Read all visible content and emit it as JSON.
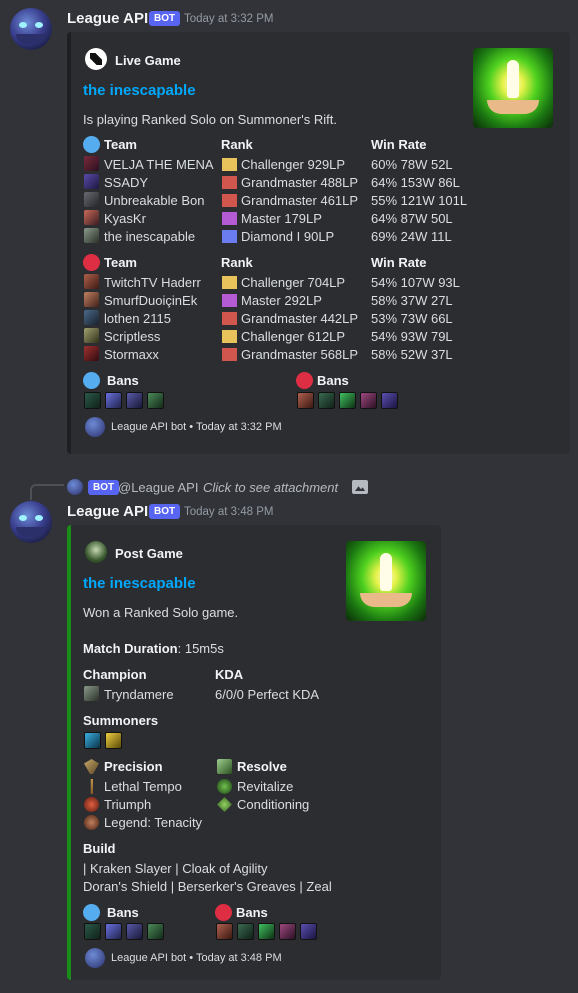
{
  "colors": {
    "background": "#313338",
    "embed": "#2b2d31",
    "link": "#00a8fc",
    "bot_tag": "#5865f2",
    "post_game_accent": "#1a8c1a",
    "blue_side": "#55acee",
    "red_side": "#dd2e44"
  },
  "message1": {
    "author": "League API",
    "bot_tag": "BOT",
    "timestamp": "Today at 3:32 PM",
    "embed": {
      "author_icon": "league-api-logo-icon",
      "author_name": "Live Game",
      "title": "the inescapable",
      "description": "Is playing Ranked Solo on Summoner's Rift.",
      "headers": {
        "team": "Team",
        "rank": "Rank",
        "winrate": "Win Rate"
      },
      "blue_team": [
        {
          "name": "VELJA THE MENA",
          "rank": "Challenger 929LP",
          "winrate": "60% 78W 52L"
        },
        {
          "name": "SSADY",
          "rank": "Grandmaster 488LP",
          "winrate": "64% 153W 86L"
        },
        {
          "name": "Unbreakable Bon",
          "rank": "Grandmaster 461LP",
          "winrate": "55% 121W 101L"
        },
        {
          "name": "KyasKr",
          "rank": "Master 179LP",
          "winrate": "64% 87W 50L"
        },
        {
          "name": "the inescapable",
          "rank": "Diamond I 90LP",
          "winrate": "69% 24W 11L"
        }
      ],
      "red_team": [
        {
          "name": "TwitchTV Haderr",
          "rank": "Challenger 704LP",
          "winrate": "54% 107W 93L"
        },
        {
          "name": "SmurfDuoiçinEk",
          "rank": "Master 292LP",
          "winrate": "58% 37W 27L"
        },
        {
          "name": "lothen 2115",
          "rank": "Grandmaster 442LP",
          "winrate": "53% 73W 66L"
        },
        {
          "name": "Scriptless",
          "rank": "Challenger 612LP",
          "winrate": "54% 93W 79L"
        },
        {
          "name": "Stormaxx",
          "rank": "Grandmaster 568LP",
          "winrate": "58% 52W 37L"
        }
      ],
      "bans_label": "Bans",
      "footer": "League API bot • Today at 3:32 PM"
    }
  },
  "reply": {
    "bot_tag": "BOT",
    "mention": "@League API",
    "text": "Click to see attachment"
  },
  "message2": {
    "author": "League API",
    "bot_tag": "BOT",
    "timestamp": "Today at 3:48 PM",
    "embed": {
      "author_name": "Post Game",
      "title": "the inescapable",
      "description": "Won a Ranked Solo game.",
      "duration_label": "Match Duration",
      "duration_value": ": 15m5s",
      "champion_label": "Champion",
      "champion_value": "Tryndamere",
      "kda_label": "KDA",
      "kda_value": "6/0/0 Perfect KDA",
      "summoners_label": "Summoners",
      "primary_tree": "Precision",
      "primary_runes": [
        "Lethal Tempo",
        "Triumph",
        "Legend: Tenacity"
      ],
      "secondary_tree": "Resolve",
      "secondary_runes": [
        "Revitalize",
        "Conditioning"
      ],
      "build_label": "Build",
      "build_line1": "| Kraken Slayer | Cloak of Agility",
      "build_line2": "Doran's Shield | Berserker's Greaves | Zeal",
      "bans_label": "Bans",
      "footer": "League API bot • Today at 3:48 PM"
    }
  }
}
